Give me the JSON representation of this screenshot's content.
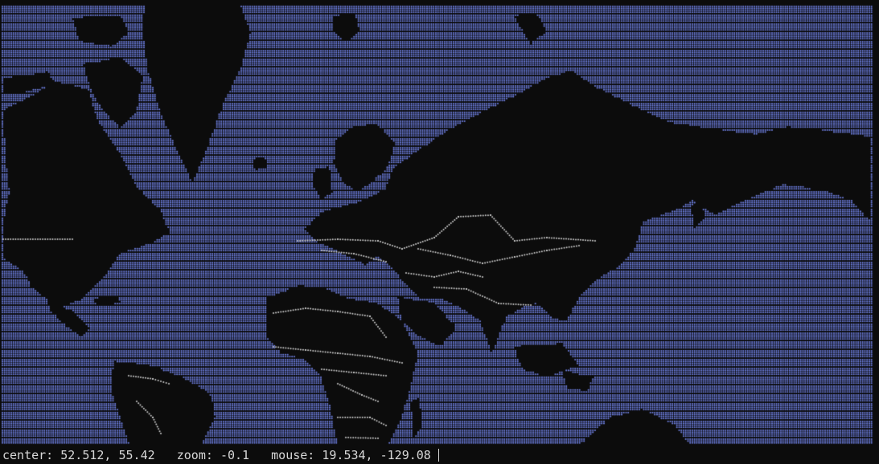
{
  "status": {
    "center_label": "center:",
    "center_value": "52.512, 55.42",
    "zoom_label": "zoom:",
    "zoom_value": "-0.1",
    "mouse_label": "mouse:",
    "mouse_value": "19.534, -129.08"
  },
  "map": {
    "ocean_color": "#6e7fe0",
    "land_color": "#0c0c0c",
    "border_color": "#d0d0d0",
    "background_color": "#0c0c0c",
    "status_text_color": "#d8d8d8"
  }
}
